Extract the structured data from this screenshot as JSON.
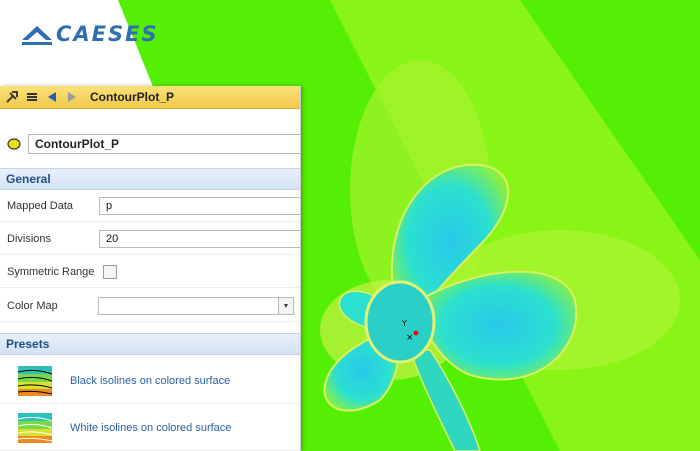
{
  "app": {
    "logo_text": "CAESES",
    "brand_color": "#2f6fb0"
  },
  "toolbar": {
    "icons": [
      "tools-icon",
      "list-icon",
      "back-arrow-icon",
      "forward-arrow-icon"
    ],
    "title": "ContourPlot_P"
  },
  "object": {
    "icon": "contour-plot-icon",
    "name": "ContourPlot_P"
  },
  "sections": {
    "general": "General",
    "presets": "Presets"
  },
  "properties": {
    "mapped_data": {
      "label": "Mapped Data",
      "value": "p"
    },
    "divisions": {
      "label": "Divisions",
      "value": "20"
    },
    "symmetric_range": {
      "label": "Symmetric Range",
      "checked": false
    },
    "color_map": {
      "label": "Color Map",
      "value": ""
    }
  },
  "presets": [
    {
      "label": "Black isolines on colored surface",
      "icon": "black-isolines-icon"
    },
    {
      "label": "White isolines on colored surface",
      "icon": "white-isolines-icon"
    }
  ],
  "viewport": {
    "axis_label": "Y",
    "colors": {
      "background": "#55ef05",
      "band": "#8ef51a",
      "blade": "#1fd4cc",
      "blade_light": "#3ee6e0",
      "hub_ring": "#d9f060"
    }
  }
}
